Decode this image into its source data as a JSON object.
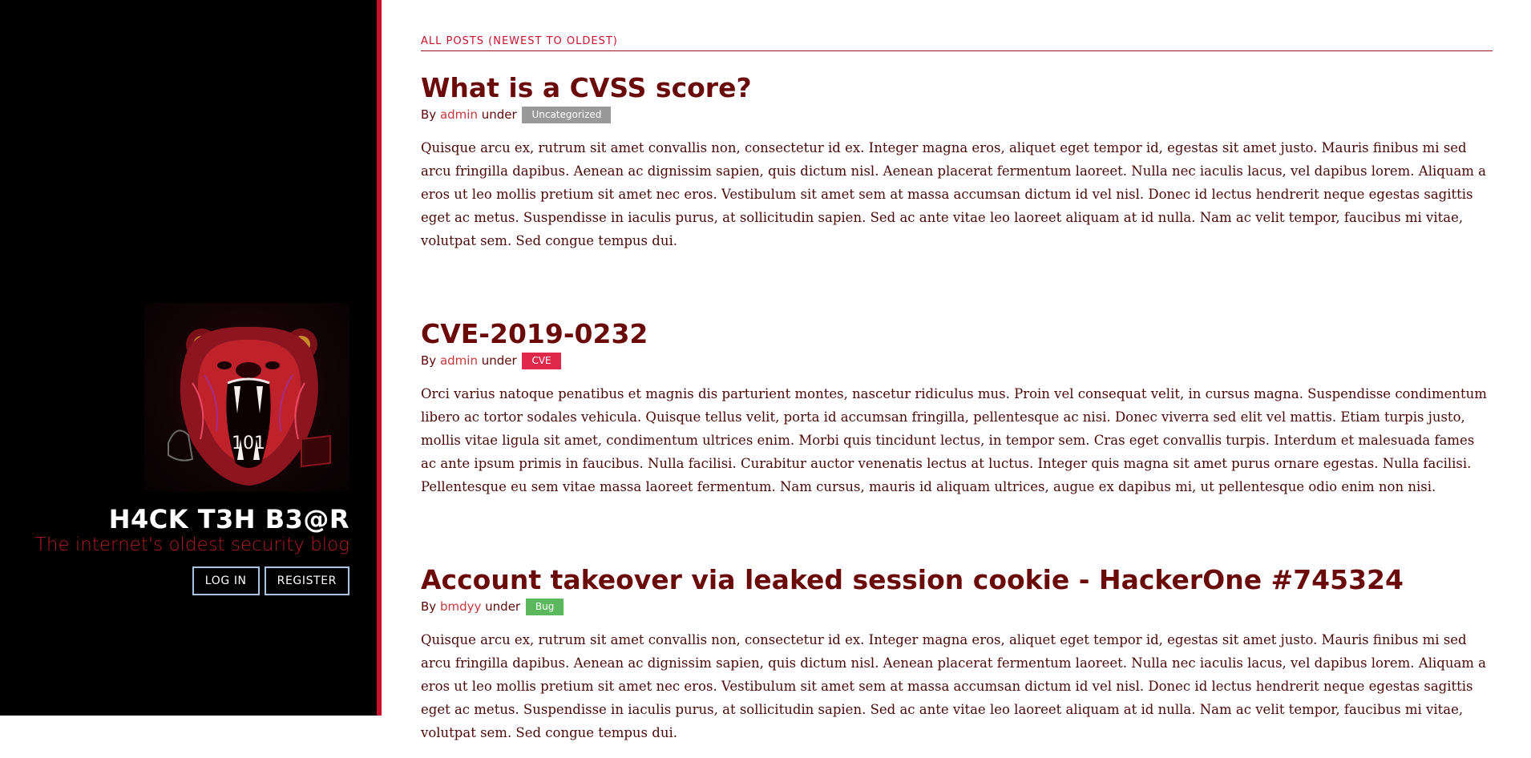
{
  "sidebar": {
    "site_title": "H4CK T3H B3@R",
    "tagline": "The internet's oldest security blog",
    "login_label": "LOG IN",
    "register_label": "REGISTER",
    "logo_icon": "red-bear-logo-icon",
    "logo_text": "101"
  },
  "main": {
    "section_header": "ALL POSTS (NEWEST TO OLDEST)",
    "posts": [
      {
        "title": "What is a CVSS score?",
        "by": "By",
        "author": "admin",
        "under": "under",
        "category": "Uncategorized",
        "category_color": "#999999",
        "body": "Quisque arcu ex, rutrum sit amet convallis non, consectetur id ex. Integer magna eros, aliquet eget tempor id, egestas sit amet justo. Mauris finibus mi sed arcu fringilla dapibus. Aenean ac dignissim sapien, quis dictum nisl. Aenean placerat fermentum laoreet. Nulla nec iaculis lacus, vel dapibus lorem. Aliquam a eros ut leo mollis pretium sit amet nec eros. Vestibulum sit amet sem at massa accumsan dictum id vel nisl. Donec id lectus hendrerit neque egestas sagittis eget ac metus. Suspendisse in iaculis purus, at sollicitudin sapien. Sed ac ante vitae leo laoreet aliquam at id nulla. Nam ac velit tempor, faucibus mi vitae, volutpat sem. Sed congue tempus dui."
      },
      {
        "title": "CVE-2019-0232",
        "by": "By",
        "author": "admin",
        "under": "under",
        "category": "CVE",
        "category_color": "#e0294a",
        "body": "Orci varius natoque penatibus et magnis dis parturient montes, nascetur ridiculus mus. Proin vel consequat velit, in cursus magna. Suspendisse condimentum libero ac tortor sodales vehicula. Quisque tellus velit, porta id accumsan fringilla, pellentesque ac nisi. Donec viverra sed elit vel mattis. Etiam turpis justo, mollis vitae ligula sit amet, condimentum ultrices enim. Morbi quis tincidunt lectus, in tempor sem. Cras eget convallis turpis. Interdum et malesuada fames ac ante ipsum primis in faucibus. Nulla facilisi. Curabitur auctor venenatis lectus at luctus. Integer quis magna sit amet purus ornare egestas. Nulla facilisi. Pellentesque eu sem vitae massa laoreet fermentum. Nam cursus, mauris id aliquam ultrices, augue ex dapibus mi, ut pellentesque odio enim non nisi."
      },
      {
        "title": "Account takeover via leaked session cookie - HackerOne #745324",
        "by": "By",
        "author": "bmdyy",
        "under": "under",
        "category": "Bug",
        "category_color": "#5cb85c",
        "body": "Quisque arcu ex, rutrum sit amet convallis non, consectetur id ex. Integer magna eros, aliquet eget tempor id, egestas sit amet justo. Mauris finibus mi sed arcu fringilla dapibus. Aenean ac dignissim sapien, quis dictum nisl. Aenean placerat fermentum laoreet. Nulla nec iaculis lacus, vel dapibus lorem. Aliquam a eros ut leo mollis pretium sit amet nec eros. Vestibulum sit amet sem at massa accumsan dictum id vel nisl. Donec id lectus hendrerit neque egestas sagittis eget ac metus. Suspendisse in iaculis purus, at sollicitudin sapien. Sed ac ante vitae leo laoreet aliquam at id nulla. Nam ac velit tempor, faucibus mi vitae, volutpat sem. Sed congue tempus dui."
      }
    ]
  },
  "colors": {
    "accent": "#c8102e",
    "title": "#6b0a0a",
    "sidebar_bg": "#000000"
  }
}
